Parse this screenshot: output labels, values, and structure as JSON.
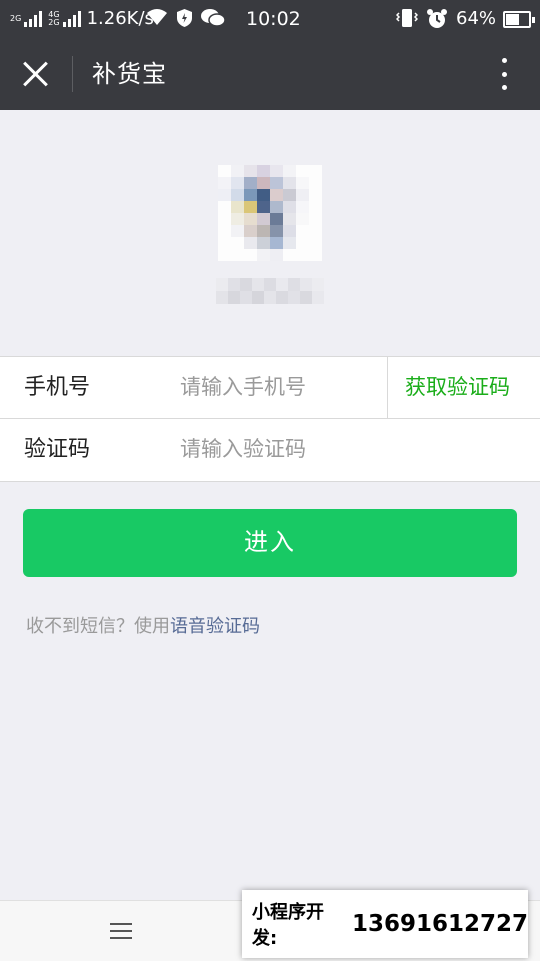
{
  "status_bar": {
    "network_top": "4G",
    "network_bottom": "2G",
    "sim2_label": "2G",
    "speed": "1.26K/s",
    "time": "10:02",
    "battery_percent": "64%",
    "battery_level": 0.64,
    "icons": [
      "signal-icon",
      "wifi-icon",
      "shield-icon",
      "wechat-icon",
      "vibrate-icon",
      "alarm-icon",
      "battery-icon"
    ]
  },
  "navbar": {
    "title": "补货宝",
    "close_icon": "close-icon",
    "more_icon": "more-icon"
  },
  "form": {
    "phone_label": "手机号",
    "phone_placeholder": "请输入手机号",
    "phone_value": "",
    "get_code_label": "获取验证码",
    "code_label": "验证码",
    "code_placeholder": "请输入验证码",
    "code_value": ""
  },
  "enter_button": "进入",
  "hint": {
    "prefix": "收不到短信？使用",
    "link": "语音验证码"
  },
  "bottom": {
    "menu_icon": "menu-icon",
    "ad_label": "小程序开发:",
    "ad_phone": "13691612727"
  },
  "colors": {
    "bar": "#393a3f",
    "background": "#efeff4",
    "accent_green": "#1aad19",
    "button_green": "#18c964",
    "link_blue": "#576b95"
  }
}
